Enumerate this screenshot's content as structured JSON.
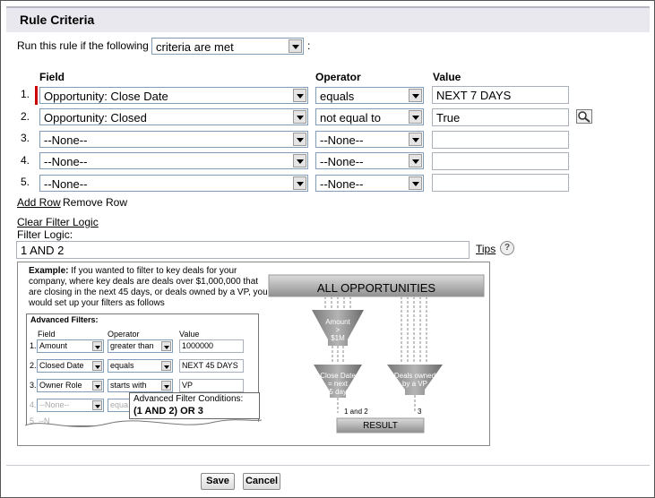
{
  "header": {
    "title": "Rule Criteria"
  },
  "run_rule": {
    "label": "Run this rule if the following",
    "selected": "criteria are met",
    "suffix": ":"
  },
  "columns": {
    "field": "Field",
    "operator": "Operator",
    "value": "Value"
  },
  "rows": [
    {
      "num": "1.",
      "field": "Opportunity: Close Date",
      "operator": "equals",
      "value": "NEXT 7 DAYS"
    },
    {
      "num": "2.",
      "field": "Opportunity: Closed",
      "operator": "not equal to",
      "value": "True"
    },
    {
      "num": "3.",
      "field": "--None--",
      "operator": "--None--",
      "value": ""
    },
    {
      "num": "4.",
      "field": "--None--",
      "operator": "--None--",
      "value": ""
    },
    {
      "num": "5.",
      "field": "--None--",
      "operator": "--None--",
      "value": ""
    }
  ],
  "links": {
    "add_row": "Add Row",
    "remove_row": "Remove Row",
    "clear_filter": "Clear Filter Logic",
    "tips": "Tips",
    "help": "?"
  },
  "filter_logic": {
    "label": "Filter Logic:",
    "value": "1 AND 2"
  },
  "example": {
    "bold": "Example:",
    "text": " If you wanted to filter to key deals for your company, where key deals are deals over $1,000,000 that are closing in the next 45 days, or deals owned by a VP, you would set up your filters as follows",
    "adv_title": "Advanced Filters:",
    "cols": {
      "field": "Field",
      "operator": "Operator",
      "value": "Value"
    },
    "rows": [
      {
        "num": "1.",
        "field": "Amount",
        "op": "greater than",
        "val": "1000000"
      },
      {
        "num": "2.",
        "field": "Closed Date",
        "op": "equals",
        "val": "NEXT 45 DAYS"
      },
      {
        "num": "3.",
        "field": "Owner Role",
        "op": "starts with",
        "val": "VP"
      },
      {
        "num": "4.",
        "field": "--None--",
        "op": "equa",
        "val": ""
      },
      {
        "num": "5.",
        "field": "--N",
        "op": "",
        "val": ""
      }
    ],
    "cond_title": "Advanced Filter Conditions:",
    "cond_pre": "(1 AND 2) ",
    "cond_or": "OR",
    "cond_post": " 3",
    "diagram": {
      "banner": "ALL OPPORTUNITIES",
      "f1a": "Amount",
      "f1b": ">",
      "f1c": "$1M",
      "f2a": "Close Date",
      "f2b": "= next",
      "f2c": "45 days",
      "f3a": "Deals owned",
      "f3b": "by a VP",
      "l1": "1 and 2",
      "l2": "3",
      "result": "RESULT"
    }
  },
  "buttons": {
    "save": "Save",
    "cancel": "Cancel"
  }
}
